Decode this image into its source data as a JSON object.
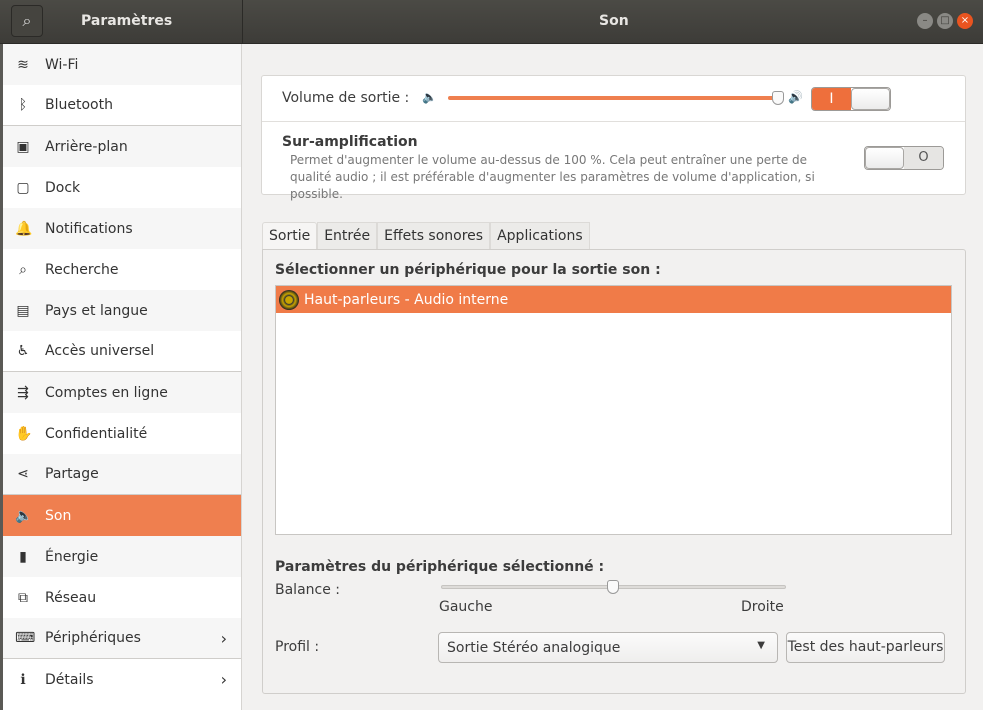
{
  "header": {
    "sidebar_title": "Paramètres",
    "page_title": "Son"
  },
  "sidebar": {
    "items": [
      {
        "label": "Wi-Fi",
        "icon": "wifi-icon",
        "glyph": "≋"
      },
      {
        "label": "Bluetooth",
        "icon": "bluetooth-icon",
        "glyph": "ᛒ"
      },
      {
        "label": "Arrière-plan",
        "icon": "background-icon",
        "glyph": "▣"
      },
      {
        "label": "Dock",
        "icon": "dock-icon",
        "glyph": "▢"
      },
      {
        "label": "Notifications",
        "icon": "bell-icon",
        "glyph": "🔔"
      },
      {
        "label": "Recherche",
        "icon": "search-icon",
        "glyph": "⌕"
      },
      {
        "label": "Pays et langue",
        "icon": "region-icon",
        "glyph": "▤"
      },
      {
        "label": "Accès universel",
        "icon": "accessibility-icon",
        "glyph": "♿"
      },
      {
        "label": "Comptes en ligne",
        "icon": "online-accounts-icon",
        "glyph": "⇶"
      },
      {
        "label": "Confidentialité",
        "icon": "privacy-hand-icon",
        "glyph": "✋"
      },
      {
        "label": "Partage",
        "icon": "share-icon",
        "glyph": "⋖"
      },
      {
        "label": "Son",
        "icon": "speaker-icon",
        "glyph": "🔈"
      },
      {
        "label": "Énergie",
        "icon": "power-icon",
        "glyph": "▮"
      },
      {
        "label": "Réseau",
        "icon": "network-icon",
        "glyph": "⧉"
      },
      {
        "label": "Périphériques",
        "icon": "devices-icon",
        "glyph": "⌨"
      },
      {
        "label": "Détails",
        "icon": "info-icon",
        "glyph": "ℹ"
      }
    ]
  },
  "volume": {
    "label": "Volume de sortie :",
    "level_percent": 100,
    "mute_toggle_on": true,
    "toggle_on_glyph": "I"
  },
  "overamp": {
    "title": "Sur-amplification",
    "description": "Permet d'augmenter le volume au-dessus de 100 %. Cela peut entraîner une perte de qualité audio ; il est préférable d'augmenter les paramètres de volume d'application, si possible.",
    "enabled": false,
    "toggle_off_glyph": "O"
  },
  "tabs": [
    "Sortie",
    "Entrée",
    "Effets sonores",
    "Applications"
  ],
  "output": {
    "select_label": "Sélectionner un périphérique pour la sortie son :",
    "devices": [
      "Haut-parleurs - Audio interne"
    ],
    "settings_label": "Paramètres du périphérique sélectionné :",
    "balance_label": "Balance :",
    "balance_left": "Gauche",
    "balance_right": "Droite",
    "balance_value": 0,
    "profile_label": "Profil :",
    "profile_value": "Sortie Stéréo analogique",
    "test_button": "Test des haut-parleurs"
  },
  "colors": {
    "accent": "#ef7f4f",
    "header": "#3d3c38"
  }
}
